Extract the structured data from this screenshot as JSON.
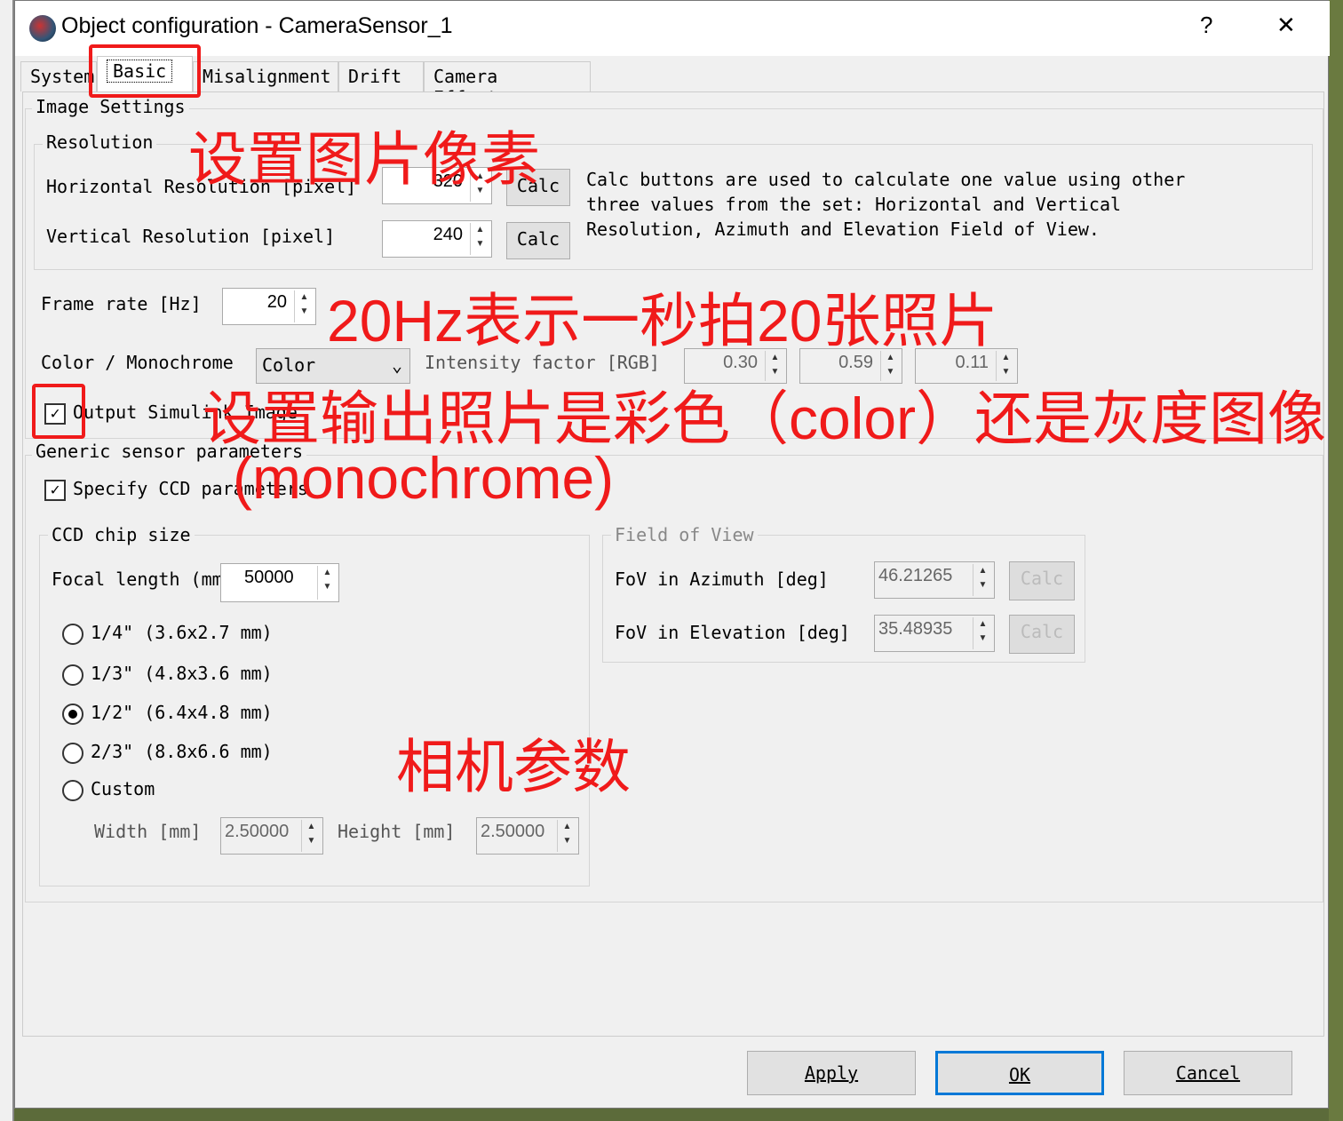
{
  "window": {
    "title": "Object configuration - CameraSensor_1",
    "help": "?",
    "close": "✕"
  },
  "tabs": [
    "System",
    "Basic",
    "Misalignment",
    "Drift",
    "Camera Effects"
  ],
  "image_settings": {
    "label": "Image Settings",
    "resolution_label": "Resolution",
    "h_label": "Horizontal Resolution [pixel]",
    "h_value": "320",
    "v_label": "Vertical Resolution [pixel]",
    "v_value": "240",
    "calc": "Calc",
    "help_text": "Calc buttons are used to calculate one value using other three values from the set: Horizontal and Vertical Resolution, Azimuth and Elevation Field of View.",
    "frame_label": "Frame rate [Hz]",
    "frame_value": "20",
    "color_label": "Color / Monochrome",
    "color_value": "Color",
    "intensity_label": "Intensity factor [RGB]",
    "intensity": [
      "0.30",
      "0.59",
      "0.11"
    ],
    "output_label": "Output Simulink Image",
    "output_checked": true
  },
  "generic": {
    "label": "Generic sensor parameters",
    "specify_label": "Specify CCD parameters",
    "specify_checked": true,
    "ccd_label": "CCD chip size",
    "focal_label": "Focal length (mm)",
    "focal_value": "50000",
    "options": [
      "1/4\" (3.6x2.7 mm)",
      "1/3\" (4.8x3.6 mm)",
      "1/2\" (6.4x4.8 mm)",
      "2/3\" (8.8x6.6 mm)",
      "Custom"
    ],
    "selected": "1/2\" (6.4x4.8 mm)",
    "width_label": "Width [mm]",
    "width_value": "2.50000",
    "height_label": "Height [mm]",
    "height_value": "2.50000",
    "fov_label": "Field of View",
    "az_label": "FoV in Azimuth [deg]",
    "az_value": "46.21265",
    "el_label": "FoV in Elevation [deg]",
    "el_value": "35.48935",
    "calc": "Calc"
  },
  "footer": {
    "apply": "Apply",
    "ok": "OK",
    "cancel": "Cancel"
  },
  "annotations": {
    "a1": "设置图片像素",
    "a2": "20Hz表示一秒拍20张照片",
    "a3": "设置输出照片是彩色（color）还是灰度图像",
    "a4": "(monochrome)",
    "a5": "相机参数",
    "color": "#f01a1a"
  }
}
